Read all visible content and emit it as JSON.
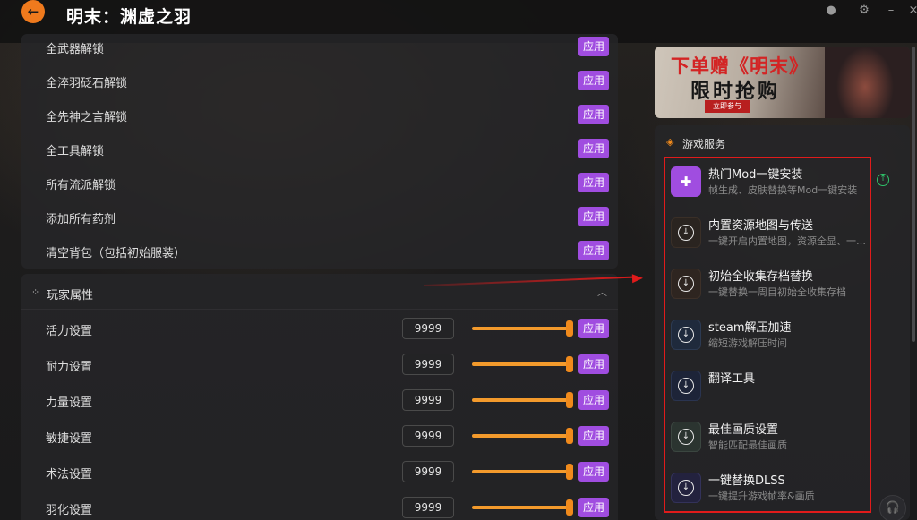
{
  "header": {
    "title": "明末：渊虚之羽",
    "back_icon": "arrow-left-icon"
  },
  "unlock_items": [
    {
      "label": "全武器解锁",
      "action": "应用"
    },
    {
      "label": "全淬羽砭石解锁",
      "action": "应用"
    },
    {
      "label": "全先神之言解锁",
      "action": "应用"
    },
    {
      "label": "全工具解锁",
      "action": "应用"
    },
    {
      "label": "所有流派解锁",
      "action": "应用"
    },
    {
      "label": "添加所有药剂",
      "action": "应用"
    },
    {
      "label": "清空背包（包括初始服装）",
      "action": "应用"
    }
  ],
  "player_attributes": {
    "title": "玩家属性",
    "items": [
      {
        "label": "活力设置",
        "value": "9999",
        "action": "应用",
        "slider_level": 1.0
      },
      {
        "label": "耐力设置",
        "value": "9999",
        "action": "应用",
        "slider_level": 1.0
      },
      {
        "label": "力量设置",
        "value": "9999",
        "action": "应用",
        "slider_level": 1.0
      },
      {
        "label": "敏捷设置",
        "value": "9999",
        "action": "应用",
        "slider_level": 1.0
      },
      {
        "label": "术法设置",
        "value": "9999",
        "action": "应用",
        "slider_level": 1.0
      },
      {
        "label": "羽化设置",
        "value": "9999",
        "action": "应用",
        "slider_level": 1.0
      }
    ]
  },
  "banner": {
    "line1": "下单赠《明末》",
    "line2": "限时抢购",
    "cta": "立即参与"
  },
  "services": {
    "title": "游戏服务",
    "items": [
      {
        "title": "热门Mod一键安装",
        "desc": "帧生成、皮肤替换等Mod一键安装"
      },
      {
        "title": "内置资源地图与传送",
        "desc": "一键开启内置地图，资源全显、一键传送"
      },
      {
        "title": "初始全收集存档替换",
        "desc": "一键替换一周目初始全收集存档"
      },
      {
        "title": "steam解压加速",
        "desc": "缩短游戏解压时间"
      },
      {
        "title": "翻译工具",
        "desc": ""
      },
      {
        "title": "最佳画质设置",
        "desc": "智能匹配最佳画质"
      },
      {
        "title": "一键替换DLSS",
        "desc": "一键提升游戏帧率&画质"
      }
    ]
  },
  "colors": {
    "accent_orange": "#f08a1c",
    "apply_purple": "#a04de0",
    "highlight_red": "#e01b1b",
    "update_green": "#2fc36a"
  }
}
